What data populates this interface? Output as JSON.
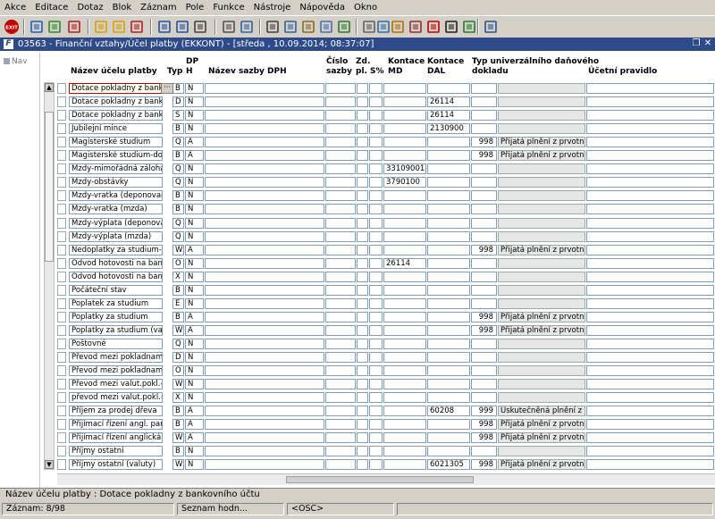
{
  "menu": [
    {
      "label": "Akce"
    },
    {
      "label": "Editace"
    },
    {
      "label": "Dotaz"
    },
    {
      "label": "Blok"
    },
    {
      "label": "Záznam"
    },
    {
      "label": "Pole"
    },
    {
      "label": "Funkce"
    },
    {
      "label": "Nástroje"
    },
    {
      "label": "Nápověda"
    },
    {
      "label": "Okno"
    }
  ],
  "toolbar": {
    "exit_label": "EXIT",
    "icons": [
      "exit-icon",
      "save-icon",
      "add-record-icon",
      "delete-record-icon",
      "query-icon",
      "execute-query-icon",
      "cancel-query-icon",
      "sort-asc-icon",
      "sort-desc-icon",
      "filter-icon",
      "print-icon",
      "mail-icon",
      "cut-icon",
      "copy-icon",
      "paste-icon",
      "find-icon",
      "edit-icon",
      "calculator-icon",
      "web-icon",
      "tools-icon",
      "block-icon",
      "question-icon",
      "sum-icon",
      "excel-icon",
      "chart-icon"
    ]
  },
  "window": {
    "title": "03563 - Finanční vztahy/Účel platby (EKKONT) - [středa , 10.09.2014; 08:37:07]",
    "restore_symbol": "❐",
    "close_symbol": "✕"
  },
  "nav": {
    "label": "Nav"
  },
  "columns": [
    {
      "key": "nazev",
      "label": "Název účelu platby"
    },
    {
      "key": "typ",
      "label": "Typ"
    },
    {
      "key": "dph",
      "label": "DP\nH"
    },
    {
      "key": "sazba",
      "label": "Název sazby DPH"
    },
    {
      "key": "cislo",
      "label": "Číslo\nsazby"
    },
    {
      "key": "zd",
      "label": "Zd.\npl."
    },
    {
      "key": "s",
      "label": "S%"
    },
    {
      "key": "md",
      "label": "Kontace\nMD"
    },
    {
      "key": "dal",
      "label": "Kontace\nDAL"
    },
    {
      "key": "typdd",
      "label": "Typ univerzálního daňového\ndokladu"
    },
    {
      "key": "ucetni",
      "label": "Účetní pravidlo"
    }
  ],
  "rows": [
    {
      "nazev": "Dotace pokladny z bankovního účtu",
      "typ": "B",
      "dph": "N",
      "md": "",
      "dal": "",
      "num": "",
      "typdd": ""
    },
    {
      "nazev": "Dotace pokladny z bankovního účtu",
      "typ": "D",
      "dph": "N",
      "md": "",
      "dal": "26114",
      "num": "",
      "typdd": ""
    },
    {
      "nazev": "Dotace pokladny z bank.účtu",
      "typ": "S",
      "dph": "N",
      "md": "",
      "dal": "26114",
      "num": "",
      "typdd": ""
    },
    {
      "nazev": "Jubilejní mince",
      "typ": "B",
      "dph": "N",
      "md": "",
      "dal": "2130900",
      "num": "",
      "typdd": ""
    },
    {
      "nazev": "Magisterské studium",
      "typ": "Q",
      "dph": "A",
      "md": "",
      "dal": "",
      "num": "998",
      "typdd": "Přijatá plnění z prvotních"
    },
    {
      "nazev": "Magisterské studium-doplatek",
      "typ": "B",
      "dph": "A",
      "md": "",
      "dal": "",
      "num": "998",
      "typdd": "Přijatá plnění z prvotních"
    },
    {
      "nazev": "Mzdy-mimořádná záloha",
      "typ": "Q",
      "dph": "N",
      "md": "33109001",
      "dal": "",
      "num": "",
      "typdd": ""
    },
    {
      "nazev": "Mzdy-obstávky",
      "typ": "Q",
      "dph": "N",
      "md": "3790100",
      "dal": "",
      "num": "",
      "typdd": ""
    },
    {
      "nazev": "Mzdy-vratka (deponovaná mzda)",
      "typ": "B",
      "dph": "N",
      "md": "",
      "dal": "",
      "num": "",
      "typdd": ""
    },
    {
      "nazev": "Mzdy-vratka (mzda)",
      "typ": "B",
      "dph": "N",
      "md": "",
      "dal": "",
      "num": "",
      "typdd": ""
    },
    {
      "nazev": "Mzdy-výplata (deponovaná mzda)",
      "typ": "Q",
      "dph": "N",
      "md": "",
      "dal": "",
      "num": "",
      "typdd": ""
    },
    {
      "nazev": "Mzdy-výplata (mzda)",
      "typ": "Q",
      "dph": "N",
      "md": "",
      "dal": "",
      "num": "",
      "typdd": ""
    },
    {
      "nazev": "Nedoplatky za studium-zahr.st.",
      "typ": "W",
      "dph": "A",
      "md": "",
      "dal": "",
      "num": "998",
      "typdd": "Přijatá plnění z prvotních"
    },
    {
      "nazev": "Odvod hotovosti na bankovní účet",
      "typ": "O",
      "dph": "N",
      "md": "26114",
      "dal": "",
      "num": "",
      "typdd": ""
    },
    {
      "nazev": "Odvod hotovosti na bankovní účet",
      "typ": "X",
      "dph": "N",
      "md": "",
      "dal": "",
      "num": "",
      "typdd": ""
    },
    {
      "nazev": "Počáteční stav",
      "typ": "B",
      "dph": "N",
      "md": "",
      "dal": "",
      "num": "",
      "typdd": ""
    },
    {
      "nazev": "Poplatek za studium",
      "typ": "E",
      "dph": "N",
      "md": "",
      "dal": "",
      "num": "",
      "typdd": ""
    },
    {
      "nazev": "Poplatky za studium",
      "typ": "B",
      "dph": "A",
      "md": "",
      "dal": "",
      "num": "998",
      "typdd": "Přijatá plnění z prvotních"
    },
    {
      "nazev": "Poplatky za studium (valuty)",
      "typ": "W",
      "dph": "A",
      "md": "",
      "dal": "",
      "num": "998",
      "typdd": "Přijatá plnění z prvotních"
    },
    {
      "nazev": "Poštovné",
      "typ": "Q",
      "dph": "N",
      "md": "",
      "dal": "",
      "num": "",
      "typdd": ""
    },
    {
      "nazev": "Převod mezi pokladnami-příjem",
      "typ": "D",
      "dph": "N",
      "md": "",
      "dal": "",
      "num": "",
      "typdd": ""
    },
    {
      "nazev": "Převod mezi pokladnami-výdej",
      "typ": "O",
      "dph": "N",
      "md": "",
      "dal": "",
      "num": "",
      "typdd": ""
    },
    {
      "nazev": "Převod mezi valut.pokl.-příjem",
      "typ": "W",
      "dph": "N",
      "md": "",
      "dal": "",
      "num": "",
      "typdd": ""
    },
    {
      "nazev": "převod mezi valut.pokl.-výdej",
      "typ": "X",
      "dph": "N",
      "md": "",
      "dal": "",
      "num": "",
      "typdd": ""
    },
    {
      "nazev": "Příjem za prodej dřeva",
      "typ": "B",
      "dph": "A",
      "md": "",
      "dal": "60208",
      "num": "999",
      "typdd": "Uskutečněná plnění z prvotních"
    },
    {
      "nazev": "Přijímací řízení angl. paral. (Kč)",
      "typ": "B",
      "dph": "A",
      "md": "",
      "dal": "",
      "num": "998",
      "typdd": "Přijatá plnění z prvotních"
    },
    {
      "nazev": "Přijímací řízení anglická paralelka",
      "typ": "W",
      "dph": "A",
      "md": "",
      "dal": "",
      "num": "998",
      "typdd": "Přijatá plnění z prvotních"
    },
    {
      "nazev": "Příjmy ostatní",
      "typ": "B",
      "dph": "N",
      "md": "",
      "dal": "",
      "num": "",
      "typdd": ""
    },
    {
      "nazev": "Příjmy ostatní (valuty)",
      "typ": "W",
      "dph": "N",
      "md": "",
      "dal": "6021305",
      "num": "998",
      "typdd": "Přijatá plnění z prvotních"
    }
  ],
  "selected_row": 0,
  "more_button": "···",
  "hint": {
    "text": "Název účelu platby : Dotace pokladny z bankovního účtu"
  },
  "status": {
    "record": "Záznam: 8/98",
    "list": "Seznam hodn...",
    "osc": "<OSC>"
  },
  "colors": {
    "title_bar": "#2e4a88",
    "cell_border": "#7f9db9",
    "selected_border": "#c00000"
  }
}
